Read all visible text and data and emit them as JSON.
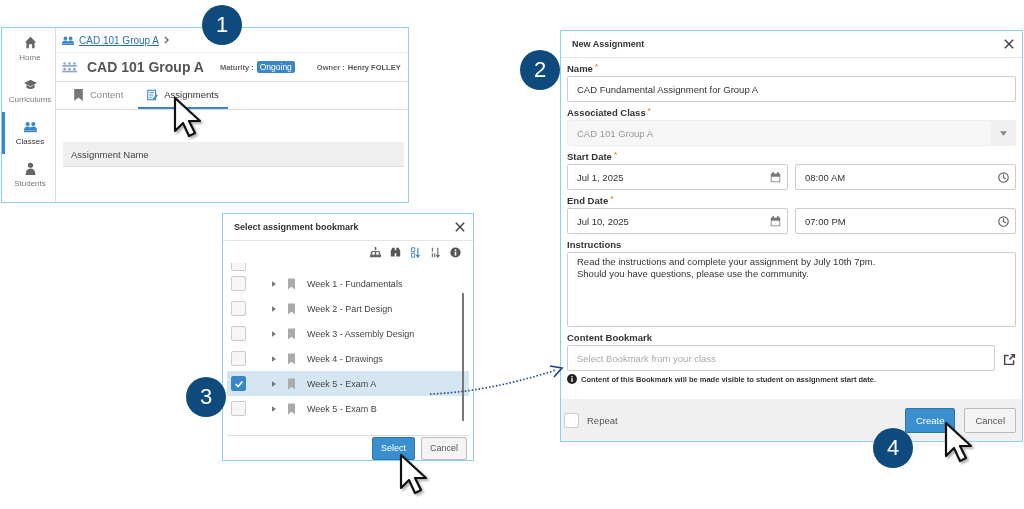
{
  "class_page": {
    "step": "1",
    "breadcrumb": "CAD 101 Group A",
    "sidebar": [
      {
        "label": "Home",
        "selected": false
      },
      {
        "label": "Curriculums",
        "selected": false
      },
      {
        "label": "Classes",
        "selected": true
      },
      {
        "label": "Students",
        "selected": false
      }
    ],
    "title": "CAD 101 Group A",
    "maturity_label": "Maturity :",
    "maturity": "Ongoing",
    "owner_label": "Owner :",
    "owner": "Henry FOLLEY",
    "tabs": [
      {
        "label": "Content",
        "selected": false
      },
      {
        "label": "Assignments",
        "selected": true
      }
    ],
    "table": {
      "columns": [
        "Assignment Name"
      ]
    }
  },
  "bookmark_dialog": {
    "step": "3",
    "title": "Select assignment bookmark",
    "cut_off_row": {
      "checked": false
    },
    "items": [
      {
        "label": "Week 1 - Fundamentals",
        "checked": false,
        "selected": false
      },
      {
        "label": "Week 2 - Part Design",
        "checked": false,
        "selected": false
      },
      {
        "label": "Week 3 - Assembly Design",
        "checked": false,
        "selected": false
      },
      {
        "label": "Week 4 - Drawings",
        "checked": false,
        "selected": false
      },
      {
        "label": "Week 5 - Exam A",
        "checked": true,
        "selected": true
      },
      {
        "label": "Week 5 - Exam B",
        "checked": false,
        "selected": false
      }
    ],
    "buttons": [
      "Select",
      "Cancel"
    ]
  },
  "assignment_dialog": {
    "step": "2",
    "title": "New Assignment",
    "name": {
      "label": "Name",
      "required_mark": "*",
      "value": "CAD Fundamental Assignment for Group A"
    },
    "associated_class": {
      "label": "Associated Class",
      "required_mark": "*",
      "value": "CAD 101 Group A",
      "disabled": true
    },
    "start": {
      "label": "Start Date",
      "required_mark": "*",
      "date": "Jul 1, 2025",
      "time": "08:00 AM"
    },
    "end": {
      "label": "End Date",
      "required_mark": "*",
      "date": "Jul 10, 2025",
      "time": "07:00 PM"
    },
    "instructions": {
      "label": "Instructions",
      "value": "Read the instructions and complete your assignment by July 10th 7pm.\nShould you have questions, please use the community."
    },
    "content_bookmark": {
      "label": "Content Bookmark",
      "placeholder": "Select Bookmark from your class",
      "note": "Content of this Bookmark will be made visible to student on assignment start date."
    },
    "repeat": {
      "label": "Repeat",
      "checked": false
    },
    "buttons": [
      "Create",
      "Cancel"
    ],
    "create_step": "4"
  }
}
